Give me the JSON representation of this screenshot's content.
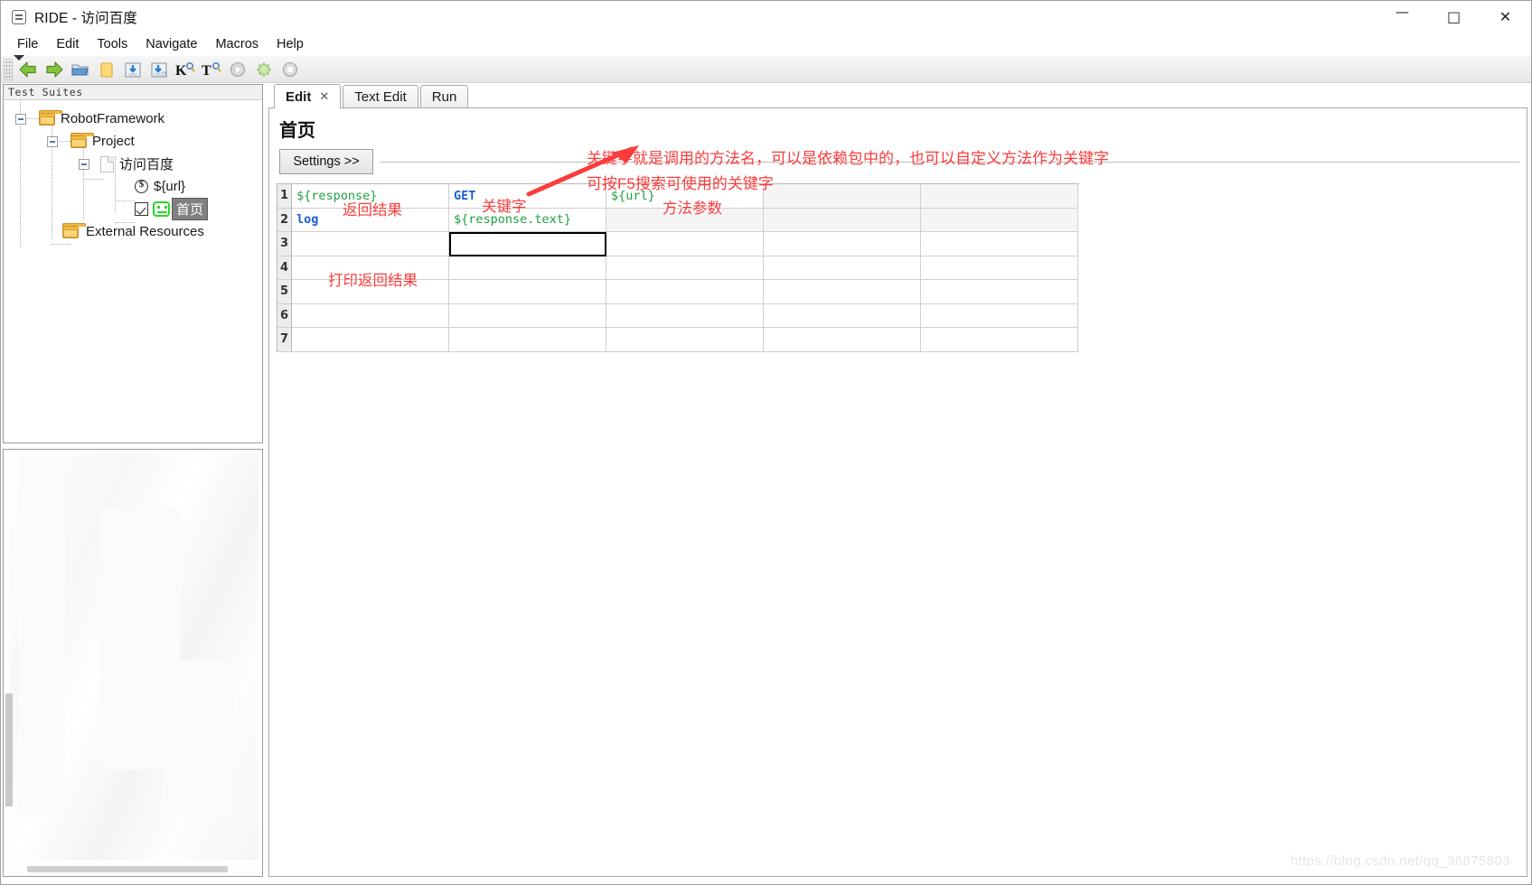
{
  "window": {
    "title": "RIDE - 访问百度",
    "app_icon": "robot-icon",
    "minimize": "—",
    "maximize": "□",
    "close": "✕"
  },
  "menubar": {
    "items": [
      {
        "label": "File"
      },
      {
        "label": "Edit"
      },
      {
        "label": "Tools"
      },
      {
        "label": "Navigate"
      },
      {
        "label": "Macros"
      },
      {
        "label": "Help"
      }
    ]
  },
  "toolbar": {
    "buttons": [
      {
        "name": "back-arrow-icon",
        "glyph": "◄"
      },
      {
        "name": "forward-arrow-icon",
        "glyph": "►"
      },
      {
        "name": "open-folder-icon",
        "glyph": "▤"
      },
      {
        "name": "new-file-icon",
        "glyph": "▯"
      },
      {
        "name": "save-icon",
        "glyph": "▼"
      },
      {
        "name": "save-all-icon",
        "glyph": "▼"
      },
      {
        "name": "search-keyword-icon",
        "glyph": "K"
      },
      {
        "name": "search-test-icon",
        "glyph": "T"
      },
      {
        "name": "run-icon",
        "glyph": "▶"
      },
      {
        "name": "debug-icon",
        "glyph": "✹"
      },
      {
        "name": "stop-icon",
        "glyph": "■"
      }
    ]
  },
  "sidebar": {
    "header": "Test Suites",
    "tree": [
      {
        "label": "RobotFramework",
        "icon": "folder-icon",
        "depth": 0,
        "expander": true
      },
      {
        "label": "Project",
        "icon": "folder-icon",
        "depth": 1,
        "expander": true
      },
      {
        "label": "访问百度",
        "icon": "file-icon",
        "depth": 2,
        "expander": true
      },
      {
        "label": "${url}",
        "icon": "variable-icon",
        "depth": 3,
        "expander": false
      },
      {
        "label": "首页",
        "icon": "testcase-icon",
        "depth": 3,
        "expander": false,
        "selected": true,
        "checked": true
      },
      {
        "label": "External Resources",
        "icon": "resources-folder-icon",
        "depth": 1,
        "expander": false
      }
    ]
  },
  "tabs": [
    {
      "label": "Edit",
      "active": true,
      "closable": true,
      "close_glyph": "✕"
    },
    {
      "label": "Text Edit",
      "active": false,
      "closable": false
    },
    {
      "label": "Run",
      "active": false,
      "closable": false
    }
  ],
  "editor": {
    "title": "首页",
    "settings_button": "Settings >>",
    "columns": 5,
    "rows": [
      {
        "num": "1",
        "cells": [
          {
            "text": "${response}",
            "style": "green"
          },
          {
            "text": "GET",
            "style": "blue"
          },
          {
            "text": "${url}",
            "style": "green"
          },
          {
            "text": "",
            "style": ""
          },
          {
            "text": "",
            "style": ""
          }
        ]
      },
      {
        "num": "2",
        "cells": [
          {
            "text": "log",
            "style": "blue"
          },
          {
            "text": "${response.text}",
            "style": "green"
          },
          {
            "text": "",
            "style": ""
          },
          {
            "text": "",
            "style": ""
          },
          {
            "text": "",
            "style": ""
          }
        ]
      },
      {
        "num": "3",
        "cells": [
          {
            "text": "",
            "style": ""
          },
          {
            "text": "",
            "style": "selected"
          },
          {
            "text": "",
            "style": ""
          },
          {
            "text": "",
            "style": ""
          },
          {
            "text": "",
            "style": ""
          }
        ]
      },
      {
        "num": "4",
        "cells": [
          {
            "text": ""
          },
          {
            "text": ""
          },
          {
            "text": ""
          },
          {
            "text": ""
          },
          {
            "text": ""
          }
        ]
      },
      {
        "num": "5",
        "cells": [
          {
            "text": ""
          },
          {
            "text": ""
          },
          {
            "text": ""
          },
          {
            "text": ""
          },
          {
            "text": ""
          }
        ]
      },
      {
        "num": "6",
        "cells": [
          {
            "text": ""
          },
          {
            "text": ""
          },
          {
            "text": ""
          },
          {
            "text": ""
          },
          {
            "text": ""
          }
        ]
      },
      {
        "num": "7",
        "cells": [
          {
            "text": ""
          },
          {
            "text": ""
          },
          {
            "text": ""
          },
          {
            "text": ""
          },
          {
            "text": ""
          }
        ]
      }
    ]
  },
  "annotations": {
    "color": "#fa3c3c",
    "note_line1": "关键字就是调用的方法名，可以是依赖包中的，也可以自定义方法作为关键字",
    "note_line2": "可按F5搜索可使用的关键字",
    "label_return_value": "返回结果",
    "label_keyword": "关键字",
    "label_method_args": "方法参数",
    "label_print_result": "打印返回结果"
  },
  "watermark": "https://blog.csdn.net/qq_36875803"
}
